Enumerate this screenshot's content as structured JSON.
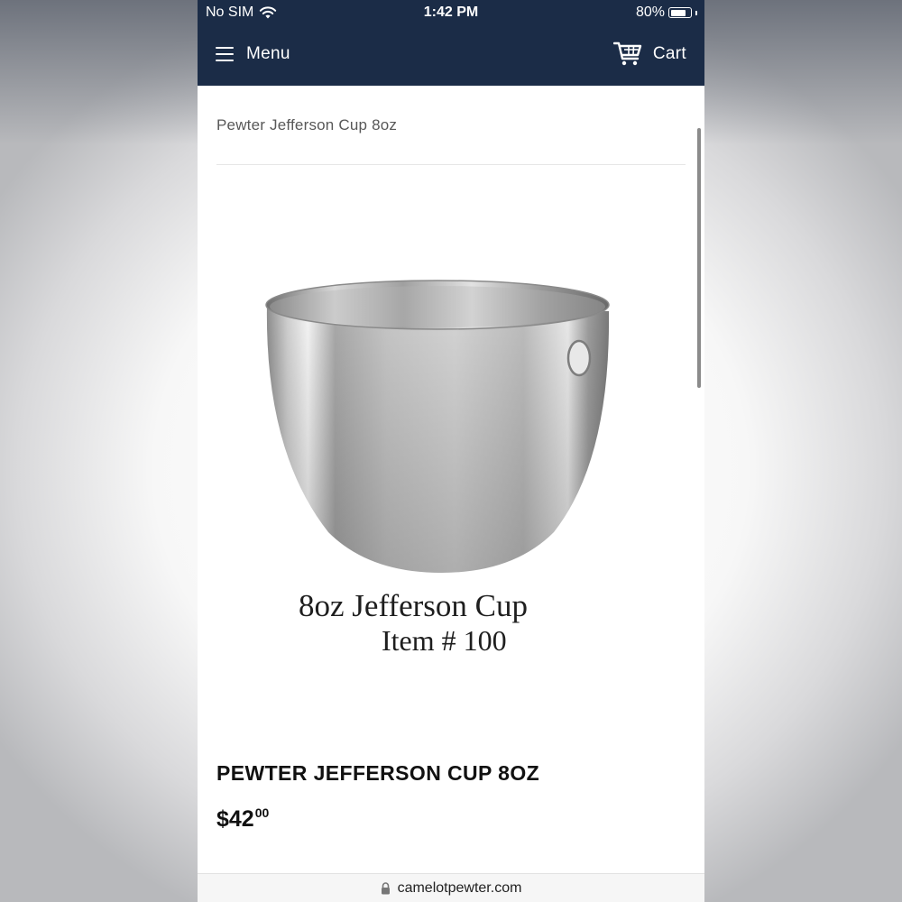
{
  "status_bar": {
    "carrier": "No SIM",
    "time": "1:42 PM",
    "battery_percent": "80%",
    "battery_level": 0.8
  },
  "nav": {
    "menu_label": "Menu",
    "cart_label": "Cart",
    "background_color": "#1b2c47"
  },
  "breadcrumb": "Pewter Jefferson Cup 8oz",
  "product": {
    "image_caption_line1": "8oz Jefferson Cup",
    "image_caption_line2": "Item # 100",
    "title": "PEWTER JEFFERSON CUP 8OZ",
    "price_dollars": "$42",
    "price_cents": "00"
  },
  "browser": {
    "url": "camelotpewter.com"
  },
  "icons": [
    "wifi-icon",
    "battery-icon",
    "hamburger-icon",
    "cart-icon",
    "lock-icon"
  ]
}
